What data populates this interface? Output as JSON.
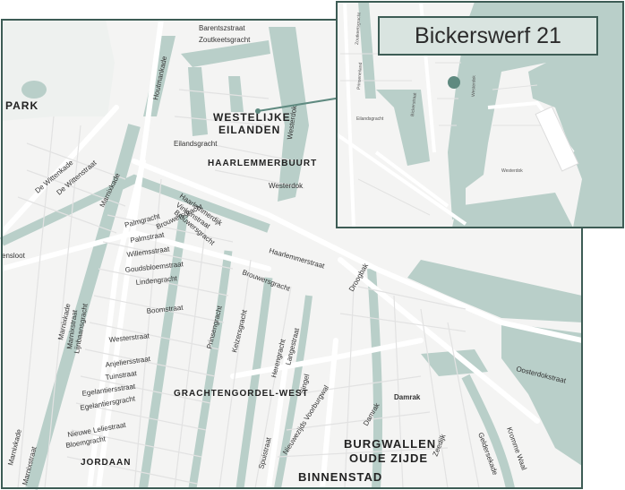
{
  "colors": {
    "land": "#f4f4f3",
    "water": "#b9cfc9",
    "road": "#ffffff",
    "road_stroke": "#dcdcdc",
    "frame": "#3d5c55",
    "marker": "#5f8a80",
    "park": "#e8ecea"
  },
  "callout": {
    "address": "Bickerswerf 21",
    "marker_icon": "location-dot-icon"
  },
  "districts": [
    "PARK",
    "WESTELIJKE",
    "EILANDEN",
    "HAARLEMMERBUURT",
    "GRACHTENGORDEL-WEST",
    "BURGWALLEN",
    "OUDE ZIJDE",
    "BINNENSTAD",
    "JORDAAN"
  ],
  "streets": [
    "Barentszstraat",
    "Zoutkeetsgracht",
    "Houtmankade",
    "Eilandsgracht",
    "Westerdok",
    "Westerdok",
    "De Wittenkade",
    "De Wittenstraat",
    "Marnixkade",
    "Haarlemmerdijk",
    "Vinkenstraat",
    "Brouwersgracht",
    "Brouwersgracht",
    "Palmgracht",
    "Palmstraat",
    "Willemsstraat",
    "Goudsbloemstraat",
    "Lindengracht",
    "Boomstraat",
    "Westerstraat",
    "Anjeliersstraat",
    "Tuinstraat",
    "Egelantiersstraat",
    "Egelantiersgracht",
    "Nieuwe Leliestraat",
    "Bloemgracht",
    "Marnixstraat",
    "Marnixkade",
    "Lijnbaansgracht",
    "Marnixkade",
    "Marnixstraat",
    "Prinsengracht",
    "Keizersgracht",
    "Herengracht",
    "Langestraat",
    "Singel",
    "Nieuwezijds Voorburgwal",
    "Spuistraat",
    "Damrak",
    "Damrak",
    "Zeedijk",
    "Geldersekade",
    "Kromme Waal",
    "Oosterdokstraat",
    "Haarlemmerstraat",
    "Droogbak",
    "Brouwersgracht",
    "ensloot"
  ],
  "inset_labels": [
    "Westerdok",
    "Westerdok",
    "Eilandsgracht",
    "Bickerstraat",
    "Prinseneiland",
    "Zoutkeetsgracht"
  ]
}
